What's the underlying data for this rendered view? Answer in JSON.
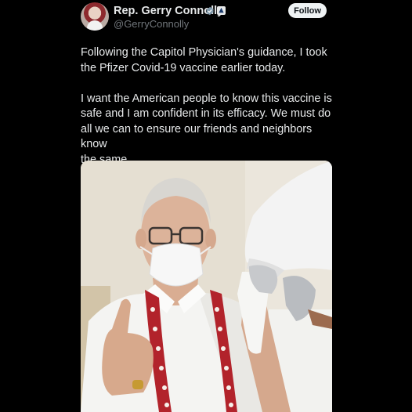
{
  "author": {
    "display_name": "Rep. Gerry Connolly",
    "handle": "@GerryConnolly",
    "avatar_icon": "profile-photo",
    "verified_icon": "verified-badge-icon",
    "verified_color": "#829aab",
    "affiliation_icon": "government-affiliation-icon"
  },
  "actions": {
    "follow_label": "Follow"
  },
  "tweet": {
    "paragraph_1": "Following the Capitol Physician's guidance, I took\nthe Pfizer Covid-19 vaccine earlier today.",
    "paragraph_2": "I want the American people to know this vaccine is\nsafe and I am confident in its efficacy. We must do\nall we can to ensure our friends and neighbors know\nthe same."
  },
  "media": {
    "type": "photo",
    "subject": "man in mask giving thumbs up while receiving vaccine"
  },
  "colors": {
    "background": "#000000",
    "text_primary": "#e7e9ea",
    "text_secondary": "#71767b",
    "follow_button_bg": "#eff3f4"
  }
}
